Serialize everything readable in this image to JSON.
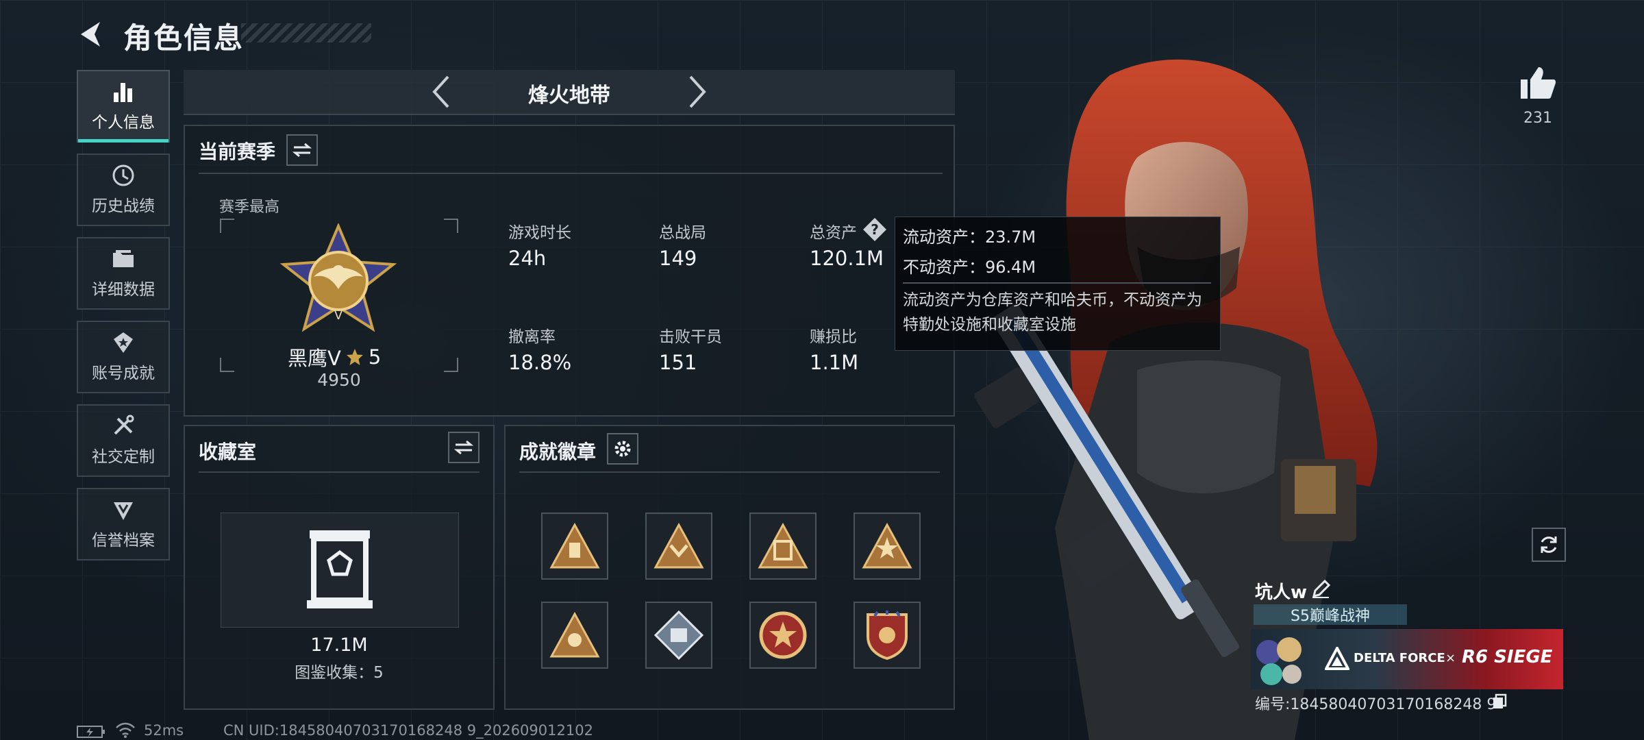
{
  "header": {
    "title": "角色信息"
  },
  "sidebar": {
    "items": [
      {
        "label": "个人信息",
        "active": true
      },
      {
        "label": "历史战绩"
      },
      {
        "label": "详细数据"
      },
      {
        "label": "账号成就"
      },
      {
        "label": "社交定制"
      },
      {
        "label": "信誉档案"
      }
    ]
  },
  "mode": {
    "title": "烽火地带"
  },
  "season": {
    "title": "当前赛季",
    "best_label": "赛季最高",
    "rank_name": "黑鹰Ⅴ",
    "rank_stars": "5",
    "rank_score": "4950",
    "stats": [
      {
        "label": "游戏时长",
        "value": "24h"
      },
      {
        "label": "总战局",
        "value": "149"
      },
      {
        "label": "总资产",
        "value": "120.1M"
      },
      {
        "label": "撤离率",
        "value": "18.8%"
      },
      {
        "label": "击败干员",
        "value": "151"
      },
      {
        "label": "赚损比",
        "value": "1.1M"
      }
    ]
  },
  "tooltip": {
    "liquid": "流动资产：23.7M",
    "fixed": "不动资产：96.4M",
    "desc": "流动资产为仓库资产和哈夫币，不动资产为特勤处设施和收藏室设施"
  },
  "collection": {
    "title": "收藏室",
    "value": "17.1M",
    "count_text": "图鉴收集：5"
  },
  "badges": {
    "title": "成就徽章"
  },
  "profile": {
    "likes": "231",
    "name": "坑人w",
    "title_tag": "S5巅峰战神",
    "banner_brand": "DELTA FORCE",
    "banner_x": "×",
    "banner_collab": "R6 SIEGE",
    "id": "编号:18458040703170168248 9"
  },
  "footer": {
    "ping": "52ms",
    "uid": "CN UID:18458040703170168248 9_202609012102"
  },
  "colors": {
    "accent": "#46d4c6",
    "gold": "#c9a24a"
  }
}
